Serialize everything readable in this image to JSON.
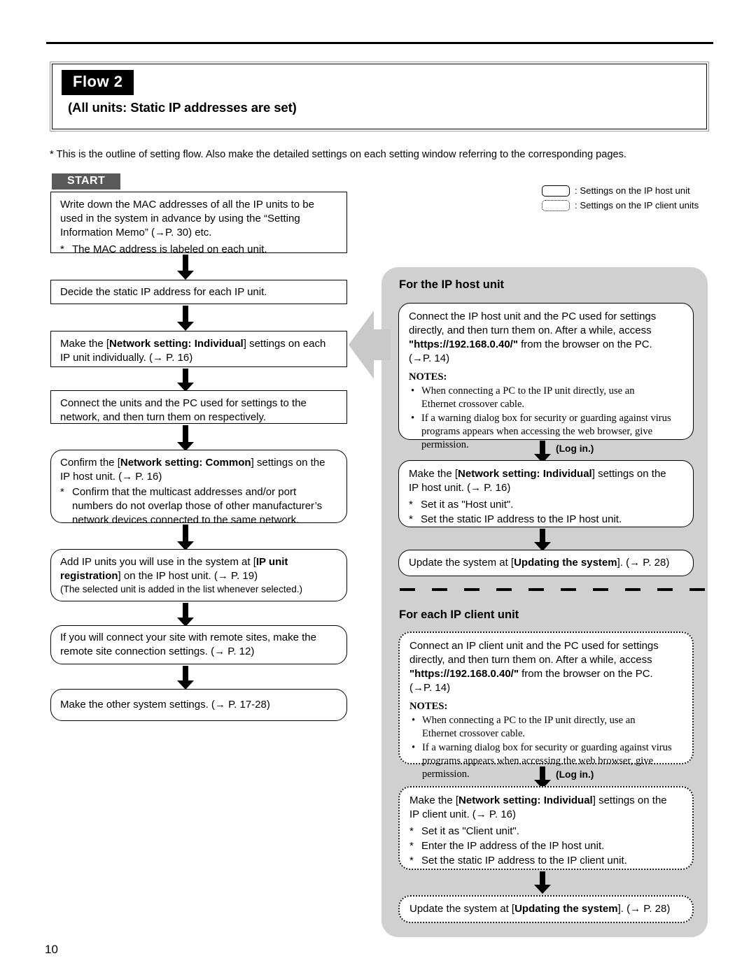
{
  "page": {
    "number": "10"
  },
  "header": {
    "flow_badge": "Flow 2",
    "subtitle": "(All units: Static IP addresses are set)",
    "outline_note": "* This is the outline of setting flow. Also make the detailed settings on each setting window referring to the corresponding pages."
  },
  "start_tab": "START",
  "legend": {
    "host": ": Settings on the IP host unit",
    "client": ": Settings on the IP client units"
  },
  "left_flow": {
    "box1": {
      "line1": "Write down the MAC addresses of all the IP units to be",
      "line2": "used in the system in advance by using the “Setting",
      "line3": "Information Memo” (→P. 30) etc.",
      "note_star": "*",
      "note": "The MAC address is labeled on each unit."
    },
    "box2": {
      "text": "Decide the static IP address for each IP unit."
    },
    "box3": {
      "pre": "Make the [",
      "bold": "Network setting: Individual",
      "post": "] settings on each",
      "line2": "IP unit individually. (→ P. 16)"
    },
    "box4": {
      "line1": "Connect the units and the PC used for settings to the",
      "line2": "network, and then turn them on respectively."
    },
    "box5": {
      "pre": "Confirm the [",
      "bold": "Network setting: Common",
      "post": "] settings on the",
      "line2": "IP host unit. (→ P. 16)",
      "note_star": "*",
      "note_l1": "Confirm that the multicast addresses and/or port",
      "note_l2": "numbers do not overlap those of other manufacturer’s",
      "note_l3": "network devices connected to the same network."
    },
    "box6": {
      "pre": "Add IP units you will use in the system at [",
      "bold1": "IP unit",
      "bold2": "registration",
      "post": "] on the IP host unit. (→ P. 19)",
      "sub": "(The selected unit is added in the list whenever selected.)"
    },
    "box7": {
      "line1": "If you will connect your site with remote sites, make the",
      "line2": "remote site connection settings. (→ P. 12)"
    },
    "box8": {
      "text": "Make the other system settings. (→ P. 17-28)"
    }
  },
  "host_section": {
    "heading": "For the IP host unit",
    "connect_box": {
      "line1": "Connect the IP host unit and the PC used for settings",
      "line2": "directly, and then turn them on. After a while, access",
      "url": "\"https://192.168.0.40/\"",
      "line3_post": " from the browser on the PC.",
      "line4": "(→P. 14)",
      "notes_title": "NOTES:",
      "notes": [
        {
          "l1": "When connecting a PC to the IP unit directly, use an",
          "l2": "Ethernet crossover cable."
        },
        {
          "l1": "If a warning dialog box for security or guarding against virus",
          "l2": "programs appears when accessing the web browser, give permission."
        }
      ]
    },
    "login_label": "(Log in.)",
    "setting_box": {
      "pre": "Make the [",
      "bold": "Network setting: Individual",
      "post": "] settings on the",
      "line2": "IP host unit. (→ P. 16)",
      "star1": "*",
      "note1": "Set it as \"Host unit\".",
      "star2": "*",
      "note2": "Set the static IP address to the IP host unit."
    },
    "update_box": {
      "pre": "Update the system at [",
      "bold": "Updating the system",
      "post": "]. (→ P. 28)"
    }
  },
  "client_section": {
    "heading": "For each IP client unit",
    "connect_box": {
      "line1": "Connect an IP client unit and the PC used for settings",
      "line2": "directly, and then turn them on. After a while, access",
      "url": "\"https://192.168.0.40/\"",
      "line3_post": " from the browser on the PC.",
      "line4": "(→P. 14)",
      "notes_title": "NOTES:",
      "notes": [
        {
          "l1": "When connecting a PC to the IP unit directly, use an",
          "l2": "Ethernet crossover cable."
        },
        {
          "l1": "If a warning dialog box for security or guarding against virus",
          "l2": "programs appears when accessing the web browser, give permission."
        }
      ]
    },
    "login_label": "(Log in.)",
    "setting_box": {
      "pre": "Make the [",
      "bold": "Network setting: Individual",
      "post": "] settings on the",
      "line2": "IP client unit. (→ P. 16)",
      "star1": "*",
      "note1": "Set it as \"Client unit\".",
      "star2": "*",
      "note2": "Enter the IP address of the IP host unit.",
      "star3": "*",
      "note3": "Set the static IP address to the IP client unit."
    },
    "update_box": {
      "pre": "Update the system at [",
      "bold": "Updating the system",
      "post": "]. (→ P. 28)"
    }
  },
  "colors": {
    "badge_bg": "#000000",
    "start_bg": "#595959",
    "panel_bg": "#d0d0d0",
    "arrow_gray": "#c9c9c9"
  }
}
